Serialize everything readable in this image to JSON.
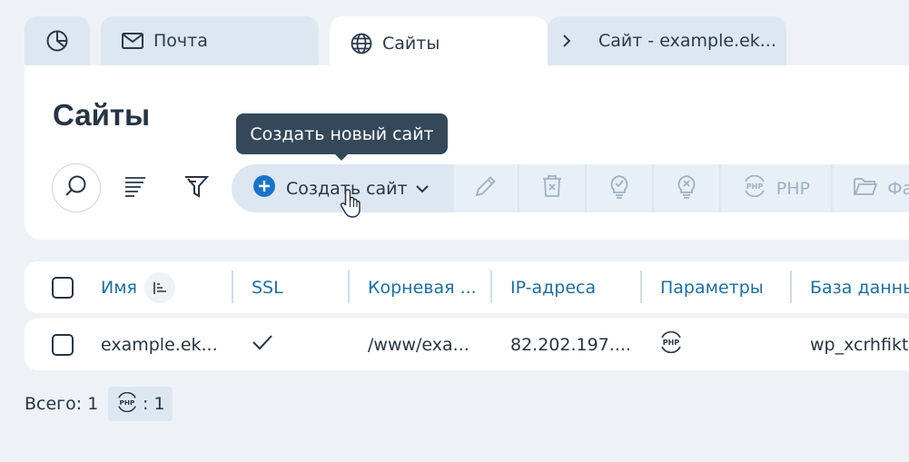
{
  "tabs": {
    "mail_label": "Почта",
    "sites_label": "Сайты",
    "site_detail_label": "Сайт - example.ek..."
  },
  "page": {
    "title": "Сайты"
  },
  "tooltip": {
    "text": "Создать новый сайт"
  },
  "toolbar": {
    "create_label": "Создать сайт",
    "php_label": "PHP",
    "files_label": "Фа"
  },
  "table": {
    "columns": [
      "Имя",
      "SSL",
      "Корневая ...",
      "IP-адреса",
      "Параметры",
      "База данны"
    ],
    "rows": [
      {
        "name": "example.ek...",
        "ssl": "✓",
        "root": "/www/exa...",
        "ip": "82.202.197....",
        "params_icon": "php-icon",
        "db": "wp_xcrhfikt"
      }
    ]
  },
  "footer": {
    "total_label": "Всего: 1",
    "php_count": ": 1"
  },
  "colors": {
    "accent": "#1f6e9b",
    "primary_blue": "#1a73c9",
    "tooltip_bg": "#344859",
    "tab_bg": "#dde7f1",
    "page_bg": "#eef2f7"
  },
  "icons": [
    "dashboard-icon",
    "mail-icon",
    "globe-icon",
    "chevron-right-icon",
    "search-icon",
    "sort-lines-icon",
    "filter-icon",
    "plus-circle-icon",
    "chevron-down-icon",
    "pencil-icon",
    "trash-icon",
    "bulb-on-icon",
    "bulb-off-icon",
    "php-icon",
    "folder-icon",
    "cursor-hand-icon",
    "sort-desc-icon"
  ]
}
